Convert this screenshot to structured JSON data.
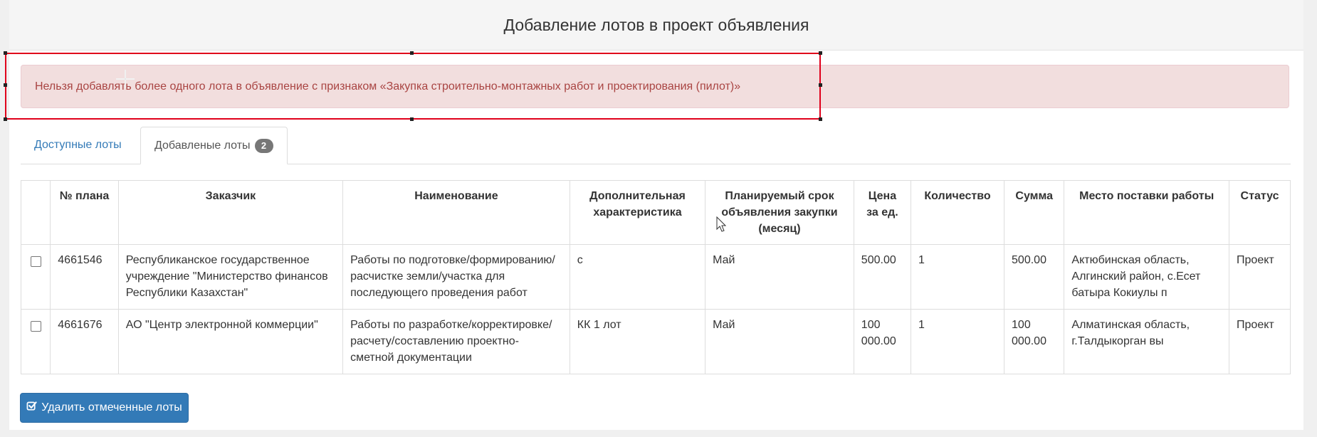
{
  "header": {
    "title": "Добавление лотов в проект объявления"
  },
  "alert": {
    "text": "Нельзя добавлять более одного лота в объявление с признаком «Закупка строительно-монтажных работ и проектирования (пилот)»"
  },
  "tabs": [
    {
      "label": "Доступные лоты",
      "active": false
    },
    {
      "label": "Добавленые лоты",
      "active": true,
      "badge": "2"
    }
  ],
  "table": {
    "headers": {
      "plan": "№ плана",
      "customer": "Заказчик",
      "name": "Наименование",
      "extra": "Дополнительная характеристика",
      "term": "Планируемый срок объявления закупки (месяц)",
      "price": "Цена за ед.",
      "qty": "Количество",
      "sum": "Сумма",
      "place": "Место поставки работы",
      "status": "Статус"
    },
    "rows": [
      {
        "plan": "4661546",
        "customer": "Республиканское государственное учреждение \"Министерство финансов Республики Казахстан\"",
        "name": "Работы по подготовке/формированию/ расчистке земли/участка для последующего проведения работ",
        "extra": "с",
        "term": "Май",
        "price": "500.00",
        "qty": "1",
        "sum": "500.00",
        "place": "Актюбинская область, Алгинский район, с.Есет батыра Кокиулы п",
        "status": "Проект"
      },
      {
        "plan": "4661676",
        "customer": "АО \"Центр электронной коммерции\"",
        "name": "Работы по разработке/корректировке/ расчету/составлению проектно-сметной документации",
        "extra": "КК 1 лот",
        "term": "Май",
        "price": "100 000.00",
        "qty": "1",
        "sum": "100 000.00",
        "place": "Алматинская область, г.Талдыкорган вы",
        "status": "Проект"
      }
    ]
  },
  "actions": {
    "delete_label": "Удалить отмеченные лоты",
    "delete_icon": "check-square-icon"
  },
  "colors": {
    "primary": "#337ab7",
    "alert_bg": "#f2dede",
    "alert_text": "#a94442",
    "selection": "#e0001b"
  }
}
